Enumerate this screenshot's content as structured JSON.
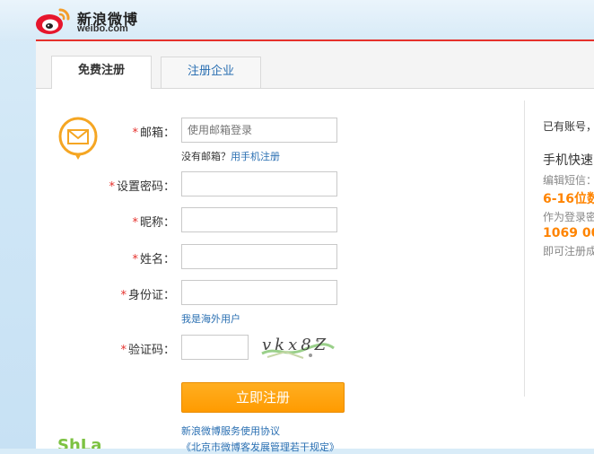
{
  "brand": {
    "name_cn": "新浪微博",
    "name_en": "weibo.com"
  },
  "tabs": [
    {
      "label": "免费注册",
      "active": true
    },
    {
      "label": "注册企业",
      "active": false
    }
  ],
  "form": {
    "email": {
      "label": "邮箱：",
      "placeholder": "使用邮箱登录"
    },
    "no_email_text": "没有邮箱？",
    "phone_register_link": "用手机注册",
    "password": {
      "label": "设置密码："
    },
    "nickname": {
      "label": "昵称："
    },
    "name": {
      "label": "姓名："
    },
    "id_card": {
      "label": "身份证："
    },
    "overseas_link": "我是海外用户",
    "captcha": {
      "label": "验证码：",
      "image_text": "vkx8Z"
    },
    "submit_label": "立即注册",
    "terms_link": "新浪微博服务使用协议",
    "terms_link2": "《北京市微博客发展管理若干规定》",
    "required_mark": "*"
  },
  "side": {
    "have_account": "已有账号，",
    "phone_fast": "手机快速",
    "edit_sms": "编辑短信：",
    "digits": "6-16位数",
    "as_password": "作为登录密",
    "sms_number": "1069 00",
    "instant": "即可注册成"
  },
  "colors": {
    "accent": "#e5312c",
    "link": "#2a6fb2",
    "button": "#ff9b00",
    "highlight": "#ff8400"
  }
}
